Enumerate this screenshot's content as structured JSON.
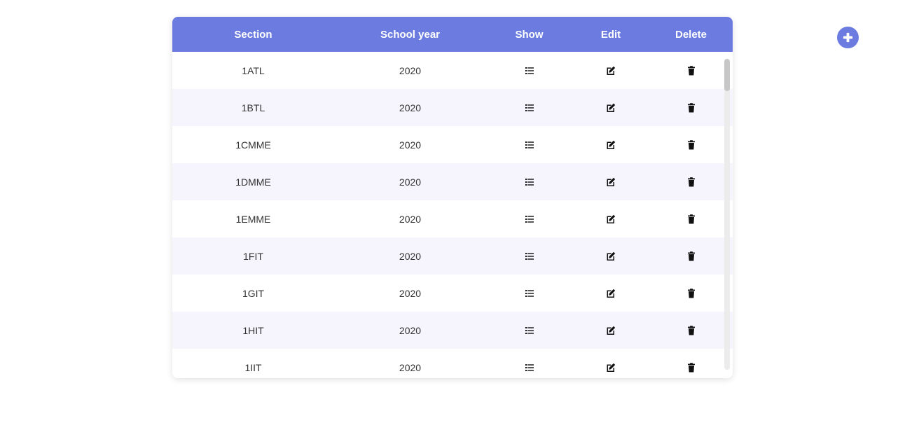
{
  "colors": {
    "header_bg": "#6b7be0",
    "row_alt_bg": "#f6f5fd",
    "accent": "#6b7be0"
  },
  "table": {
    "headers": {
      "section": "Section",
      "school_year": "School year",
      "show": "Show",
      "edit": "Edit",
      "delete": "Delete"
    },
    "rows": [
      {
        "section": "1ATL",
        "year": "2020"
      },
      {
        "section": "1BTL",
        "year": "2020"
      },
      {
        "section": "1CMME",
        "year": "2020"
      },
      {
        "section": "1DMME",
        "year": "2020"
      },
      {
        "section": "1EMME",
        "year": "2020"
      },
      {
        "section": "1FIT",
        "year": "2020"
      },
      {
        "section": "1GIT",
        "year": "2020"
      },
      {
        "section": "1HIT",
        "year": "2020"
      },
      {
        "section": "1IIT",
        "year": "2020"
      }
    ],
    "row_icons": {
      "show": "list-icon",
      "edit": "edit-icon",
      "delete": "trash-icon"
    }
  },
  "add_button": {
    "icon": "plus-circle-icon"
  }
}
